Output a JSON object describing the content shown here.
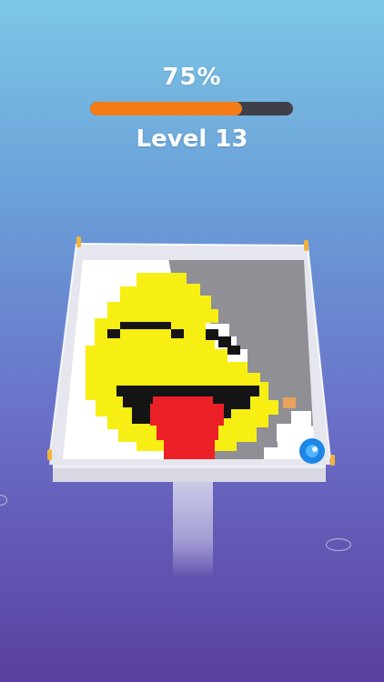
{
  "hud": {
    "percent_label": "75%",
    "progress": 0.75,
    "level_label": "Level 13"
  },
  "board": {
    "pixel_art": "smiley-face-tongue-out",
    "colors": {
      "white": "#ffffff",
      "yellow": "#f7ee14",
      "black": "#141414",
      "red": "#ec2027",
      "gray": "#8f8f95",
      "orange": "#f57c16",
      "ball": "#1e86e6",
      "post": "#f0b43a"
    }
  }
}
